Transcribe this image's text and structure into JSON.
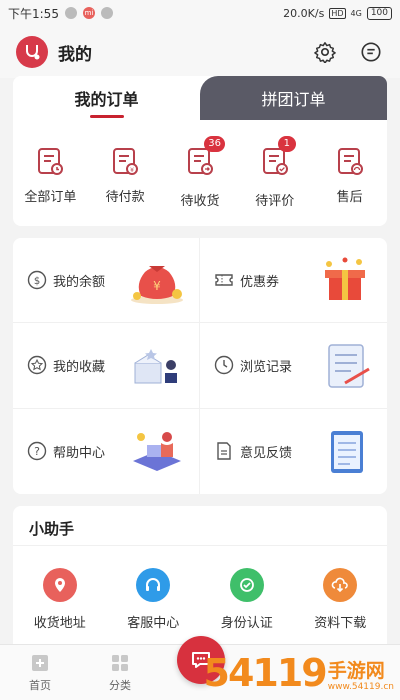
{
  "status_bar": {
    "time": "下午1:55",
    "speed": "20.0K/s",
    "hd": "HD",
    "signal": "4G",
    "battery": "100"
  },
  "header": {
    "title": "我的"
  },
  "orders": {
    "tabs": [
      "我的订单",
      "拼团订单"
    ],
    "items": [
      {
        "label": "全部订单",
        "badge": ""
      },
      {
        "label": "待付款",
        "badge": ""
      },
      {
        "label": "待收货",
        "badge": "36"
      },
      {
        "label": "待评价",
        "badge": "1"
      },
      {
        "label": "售后",
        "badge": ""
      }
    ]
  },
  "services": [
    {
      "label": "我的余额",
      "icon": "balance-icon"
    },
    {
      "label": "优惠券",
      "icon": "coupon-icon"
    },
    {
      "label": "我的收藏",
      "icon": "favorites-icon"
    },
    {
      "label": "浏览记录",
      "icon": "history-icon"
    },
    {
      "label": "帮助中心",
      "icon": "help-icon"
    },
    {
      "label": "意见反馈",
      "icon": "feedback-icon"
    }
  ],
  "helper": {
    "title": "小助手",
    "items": [
      {
        "label": "收货地址",
        "color": "#e8615c"
      },
      {
        "label": "客服中心",
        "color": "#2f9be8"
      },
      {
        "label": "身份认证",
        "color": "#3fbf6a"
      },
      {
        "label": "资料下载",
        "color": "#ef8a3a"
      }
    ]
  },
  "nav": {
    "items": [
      "首页",
      "分类"
    ]
  },
  "watermark": {
    "number": "54119",
    "site": "手游网",
    "url": "www.54119.cn"
  },
  "colors": {
    "accent": "#c8222f",
    "tab_dark": "#5a5a66"
  }
}
